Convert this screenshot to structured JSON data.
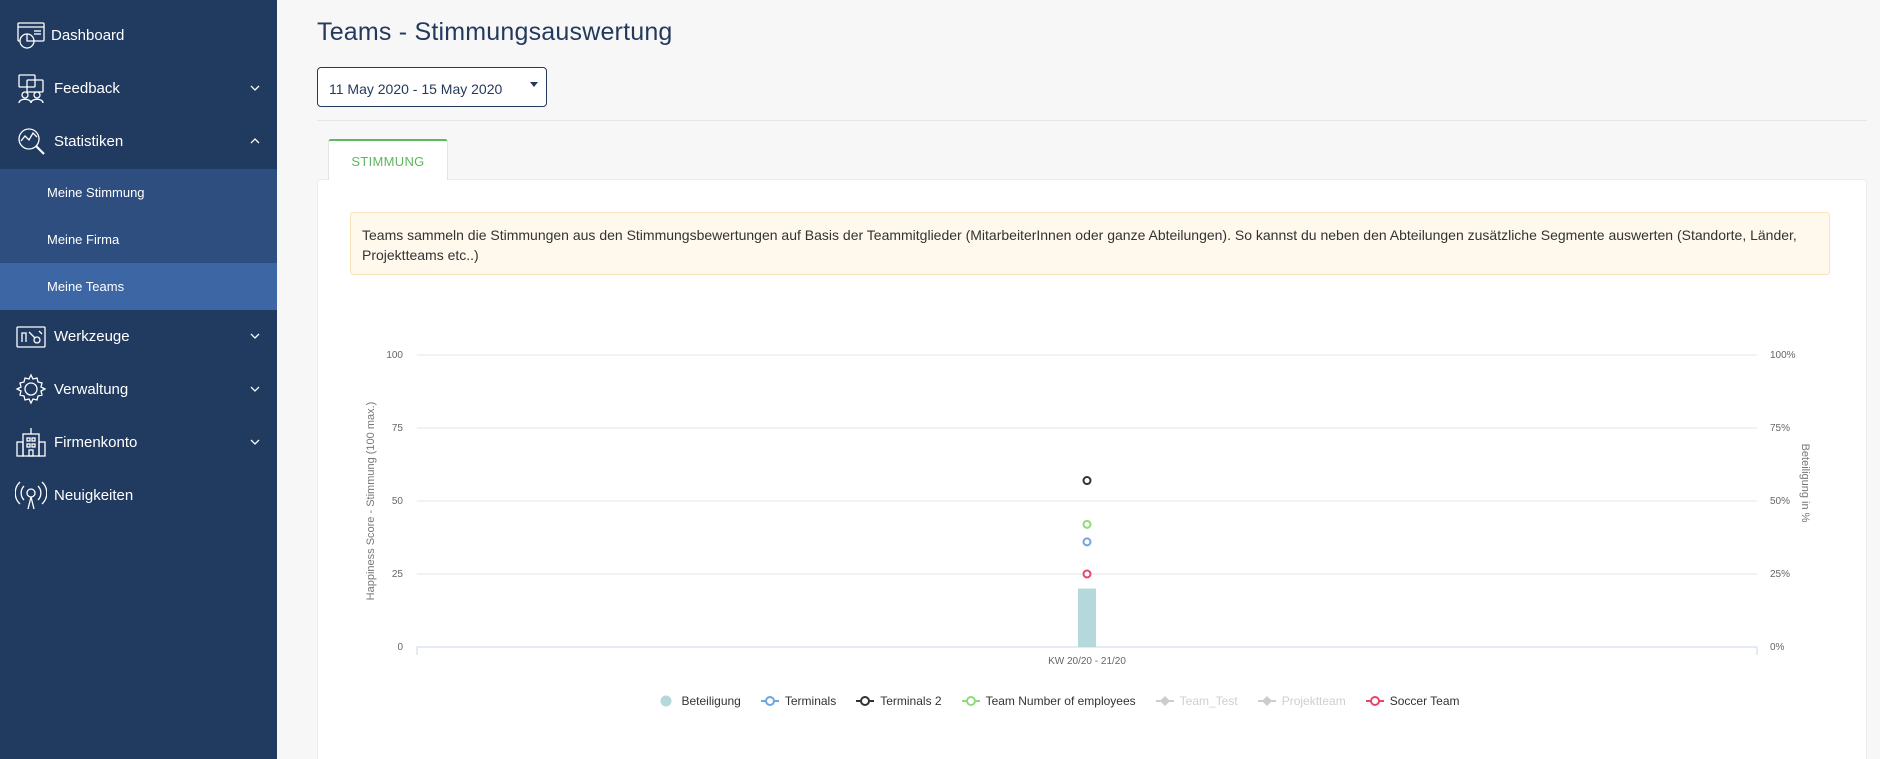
{
  "sidebar": {
    "items": [
      {
        "label": "Dashboard",
        "icon": "dashboard-icon",
        "chevron": ""
      },
      {
        "label": "Feedback",
        "icon": "feedback-icon",
        "chevron": "down"
      },
      {
        "label": "Statistiken",
        "icon": "statistics-icon",
        "chevron": "up"
      },
      {
        "label": "Werkzeuge",
        "icon": "tools-icon",
        "chevron": "down"
      },
      {
        "label": "Verwaltung",
        "icon": "settings-icon",
        "chevron": "down"
      },
      {
        "label": "Firmenkonto",
        "icon": "company-icon",
        "chevron": "down"
      },
      {
        "label": "Neuigkeiten",
        "icon": "news-icon",
        "chevron": ""
      }
    ],
    "sub_items": [
      {
        "label": "Meine Stimmung",
        "active": false
      },
      {
        "label": "Meine Firma",
        "active": false
      },
      {
        "label": "Meine Teams",
        "active": true
      }
    ]
  },
  "header": {
    "title": "Teams - Stimmungsauswertung",
    "date_range": "11 May 2020 - 15 May 2020"
  },
  "tabs": [
    {
      "label": "STIMMUNG",
      "active": true
    }
  ],
  "alert": {
    "text": "Teams sammeln die Stimmungen aus den Stimmungsbewertungen auf Basis der Teammitglieder (MitarbeiterInnen oder ganze Abteilungen). So kannst du neben den Abteilungen zusätzliche Segmente auswerten (Standorte, Länder, Projektteams etc..)"
  },
  "colors": {
    "sidebar_bg": "#213a5f",
    "sub_bg": "#2d4e7e",
    "sub_active_bg": "#3c66a4",
    "title": "#243a5c",
    "tab_accent": "#5cb85c"
  },
  "chart_data": {
    "type": "bar+scatter",
    "categories": [
      "KW 20/20 - 21/20"
    ],
    "ylabel": "Happiness Score - Stimmung (100 max.)",
    "y2label": "Beteiligung in %",
    "ylim": [
      0,
      100
    ],
    "yticks": [
      "0",
      "25",
      "50",
      "75",
      "100"
    ],
    "y2lim": [
      0,
      100
    ],
    "y2ticks": [
      "0%",
      "25%",
      "50%",
      "75%",
      "100%"
    ],
    "grid": true,
    "legend_position": "bottom",
    "series": [
      {
        "name": "Beteiligung",
        "kind": "bar",
        "axis": "right",
        "color": "#b4d8dc",
        "values": [
          20
        ],
        "hidden": false
      },
      {
        "name": "Terminals",
        "kind": "line",
        "axis": "left",
        "color": "#6ea6df",
        "values": [
          36
        ],
        "hidden": false
      },
      {
        "name": "Terminals 2",
        "kind": "line",
        "axis": "left",
        "color": "#333333",
        "values": [
          57
        ],
        "hidden": false
      },
      {
        "name": "Team Number of employees",
        "kind": "line",
        "axis": "left",
        "color": "#8fdb78",
        "values": [
          42
        ],
        "hidden": false
      },
      {
        "name": "Team_Test",
        "kind": "line",
        "axis": "left",
        "color": "#cccccc",
        "values": [],
        "hidden": true
      },
      {
        "name": "Projektteam",
        "kind": "line",
        "axis": "left",
        "color": "#cccccc",
        "values": [],
        "hidden": true
      },
      {
        "name": "Soccer Team",
        "kind": "line",
        "axis": "left",
        "color": "#e9446a",
        "values": [
          25
        ],
        "hidden": false
      }
    ]
  }
}
